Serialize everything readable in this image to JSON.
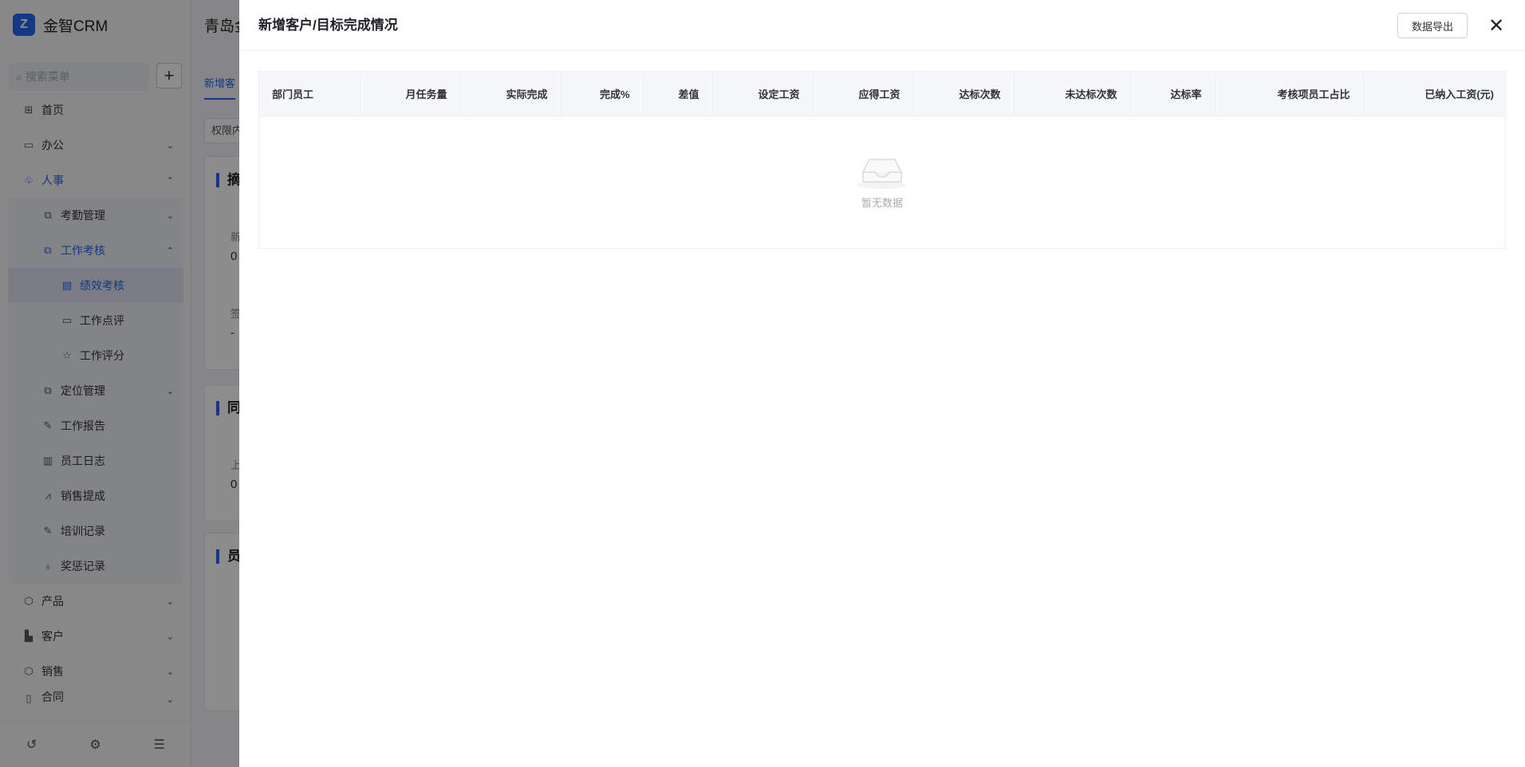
{
  "app": {
    "brand_logo_glyph": "Z",
    "brand_name": "金智CRM",
    "search_placeholder": "搜索菜单",
    "add_glyph": "+",
    "page_title": "青岛金",
    "active_tab": "新增客",
    "filter_value": "权限内",
    "cards": [
      {
        "title": "摘",
        "label1": "新",
        "value1": "0",
        "label2": "签",
        "value2": "-"
      },
      {
        "title": "同",
        "label1": "上",
        "value1": "0"
      },
      {
        "title": "员"
      }
    ]
  },
  "sidebar": {
    "items": [
      {
        "label": "首页",
        "icon": "home-icon",
        "glyph": "⊞"
      },
      {
        "label": "办公",
        "icon": "office-icon",
        "glyph": "▭"
      },
      {
        "label": "人事",
        "icon": "hr-icon",
        "glyph": "♧"
      },
      {
        "label": "考勤管理",
        "icon": "copy-icon",
        "glyph": "⧉"
      },
      {
        "label": "工作考核",
        "icon": "copy-icon",
        "glyph": "⧉"
      },
      {
        "label": "绩效考核",
        "icon": "chart-doc-icon",
        "glyph": "▤"
      },
      {
        "label": "工作点评",
        "icon": "comment-icon",
        "glyph": "▭"
      },
      {
        "label": "工作评分",
        "icon": "star-icon",
        "glyph": "☆"
      },
      {
        "label": "定位管理",
        "icon": "copy-icon",
        "glyph": "⧉"
      },
      {
        "label": "工作报告",
        "icon": "report-icon",
        "glyph": "✎"
      },
      {
        "label": "员工日志",
        "icon": "log-icon",
        "glyph": "▥"
      },
      {
        "label": "销售提成",
        "icon": "sales-chart-icon",
        "glyph": "⩘"
      },
      {
        "label": "培训记录",
        "icon": "training-icon",
        "glyph": "✎"
      },
      {
        "label": "奖惩记录",
        "icon": "award-icon",
        "glyph": "♁"
      },
      {
        "label": "产品",
        "icon": "product-icon",
        "glyph": "⬡"
      },
      {
        "label": "客户",
        "icon": "customer-icon",
        "glyph": "▙"
      },
      {
        "label": "销售",
        "icon": "sales-icon",
        "glyph": "⬡"
      },
      {
        "label": "合同",
        "icon": "contract-icon",
        "glyph": "▯"
      }
    ],
    "footer": {
      "history_glyph": "↺",
      "settings_glyph": "⚙",
      "collapse_glyph": "☰"
    }
  },
  "drawer": {
    "title": "新增客户/目标完成情况",
    "export_label": "数据导出",
    "close_glyph": "✕",
    "table": {
      "columns": [
        "部门员工",
        "月任务量",
        "实际完成",
        "完成%",
        "差值",
        "设定工资",
        "应得工资",
        "达标次数",
        "未达标次数",
        "达标率",
        "考核项员工占比",
        "已纳入工资(元)"
      ],
      "rows": [],
      "empty_text": "暂无数据"
    }
  },
  "colors": {
    "accent": "#2468f2",
    "mask": "rgba(0,0,0,0.45)"
  }
}
